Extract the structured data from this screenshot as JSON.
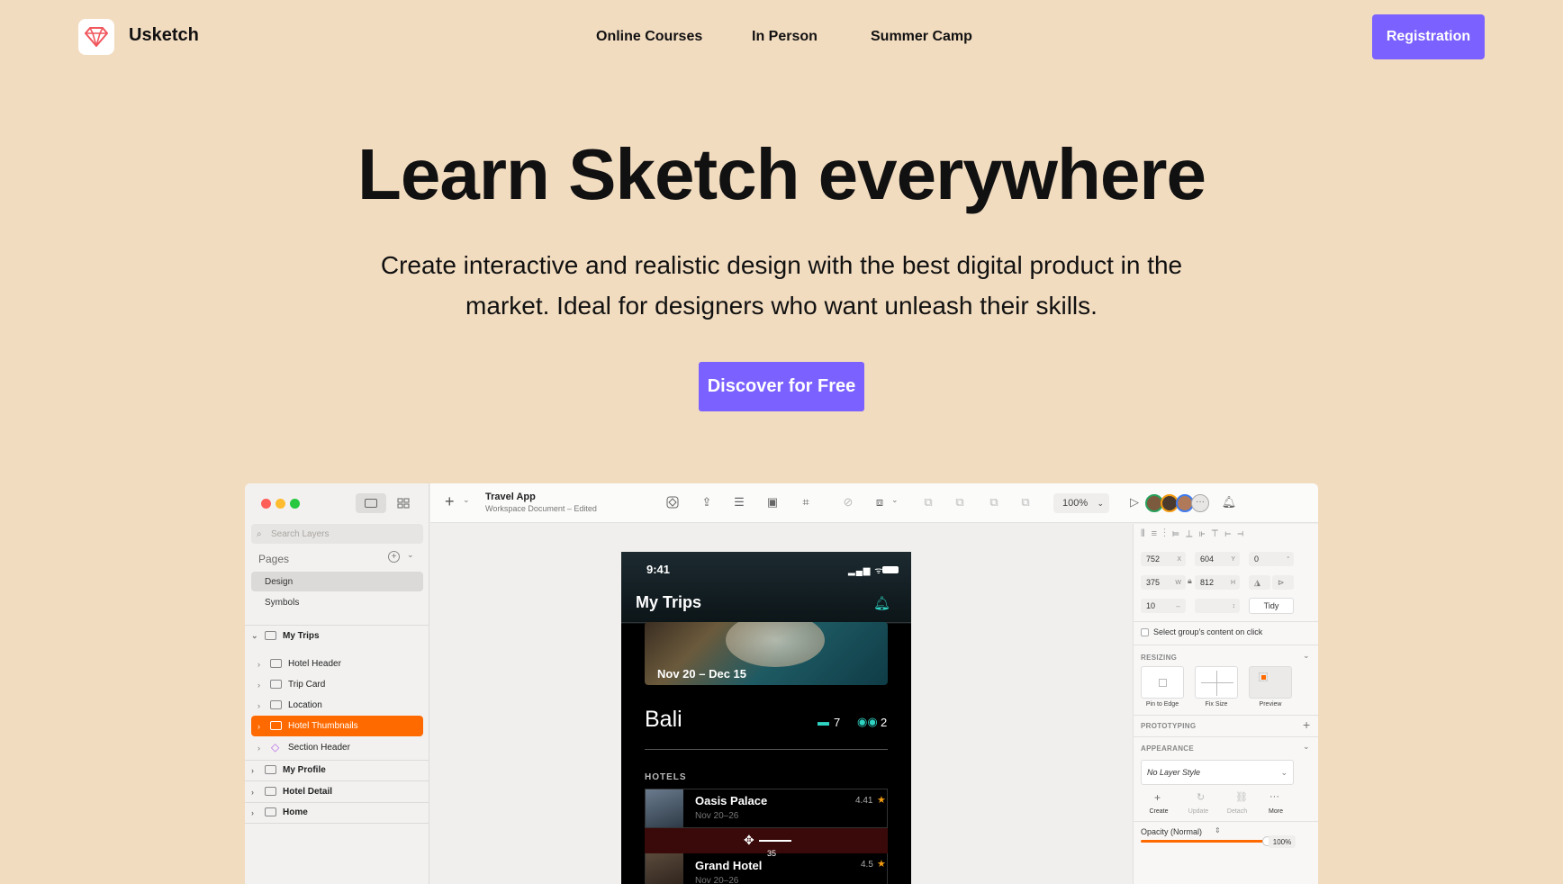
{
  "brand": {
    "name": "Usketch"
  },
  "nav": {
    "links": [
      "Online Courses",
      "In Person",
      "Summer Camp"
    ],
    "cta": "Registration"
  },
  "hero": {
    "title": "Learn Sketch everywhere",
    "subtitle_line1": "Create interactive and realistic design with the best digital product in the",
    "subtitle_line2": "market. Ideal for designers who want unleash their skills.",
    "cta": "Discover for Free"
  },
  "colors": {
    "background": "#f2dcc0",
    "accent": "#7b61ff",
    "highlight": "#ff6a00"
  },
  "app": {
    "doc_title": "Travel App",
    "doc_subtitle": "Workspace Document – Edited",
    "zoom": "100%",
    "search_placeholder": "Search Layers",
    "pages_label": "Pages",
    "pages": [
      "Design",
      "Symbols"
    ],
    "layers": {
      "group": "My Trips",
      "children": [
        "Hotel Header",
        "Trip Card",
        "Location",
        "Hotel Thumbnails",
        "Section Header"
      ],
      "others": [
        "My Profile",
        "Hotel Detail",
        "Home"
      ]
    },
    "inspector": {
      "x": "752",
      "y": "604",
      "rotation": "0",
      "w": "375",
      "h": "812",
      "spacing": "10",
      "x_suffix": "X",
      "y_suffix": "Y",
      "rot_suffix": "°",
      "w_suffix": "W",
      "h_suffix": "H",
      "tidy": "Tidy",
      "select_group": "Select group's content on click",
      "resizing": "RESIZING",
      "resize_opts": [
        "Pin to Edge",
        "Fix Size",
        "Preview"
      ],
      "prototyping": "PROTOTYPING",
      "appearance": "APPEARANCE",
      "layer_style": "No Layer Style",
      "style_actions": [
        "Create",
        "Update",
        "Detach",
        "More"
      ],
      "opacity": "Opacity (Normal)",
      "opacity_value": "100%"
    },
    "phone": {
      "time": "9:41",
      "title": "My Trips",
      "trip_dates": "Nov 20 – Dec 15",
      "location": "Bali",
      "beds": "7",
      "binoculars": "2",
      "hotels_label": "HOTELS",
      "hotels": [
        {
          "name": "Oasis Palace",
          "dates": "Nov 20–26",
          "rating": "4.41"
        },
        {
          "name": "Grand Hotel",
          "dates": "Nov 20–26",
          "rating": "4.5"
        }
      ],
      "drag_value": "35"
    }
  }
}
